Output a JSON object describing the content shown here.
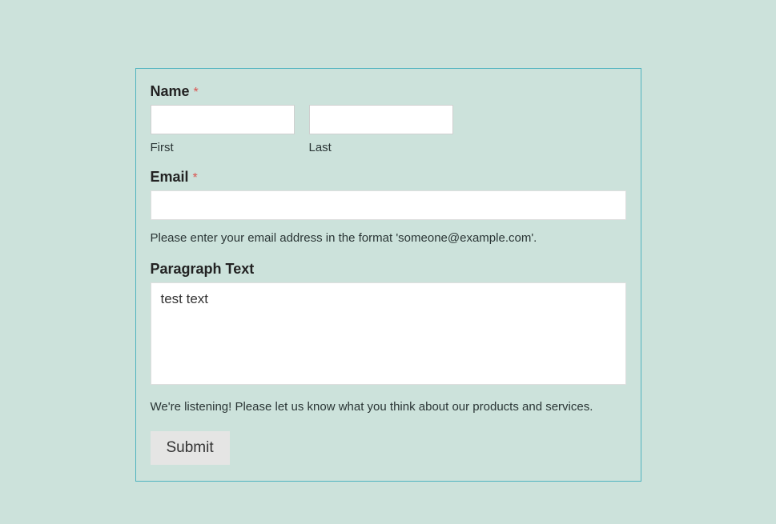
{
  "name": {
    "label": "Name",
    "required_mark": "*",
    "first": {
      "sublabel": "First",
      "value": ""
    },
    "last": {
      "sublabel": "Last",
      "value": ""
    }
  },
  "email": {
    "label": "Email",
    "required_mark": "*",
    "value": "",
    "hint": "Please enter your email address in the format 'someone@example.com'."
  },
  "paragraph": {
    "label": "Paragraph Text",
    "value": "test text",
    "hint": "We're listening! Please let us know what you think about our products and services."
  },
  "submit": {
    "label": "Submit"
  }
}
